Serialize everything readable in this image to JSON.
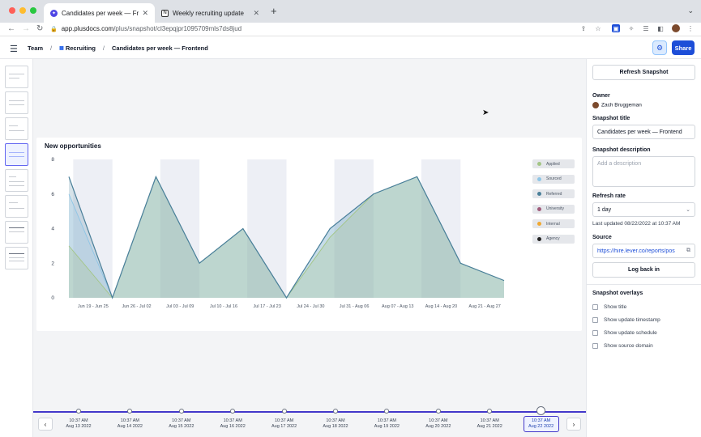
{
  "browser": {
    "tabs": [
      {
        "title": "Candidates per week — Fronte",
        "active": true
      },
      {
        "title": "Weekly recruiting update",
        "active": false
      }
    ],
    "url_host": "app.plusdocs.com",
    "url_path": "/plus/snapshot/cl3epqjpr1095709mls7ds8jud"
  },
  "header": {
    "breadcrumbs": [
      "Team",
      "Recruiting",
      "Candidates per week — Frontend"
    ],
    "share_label": "Share"
  },
  "chart_data": {
    "type": "area",
    "title": "New opportunities",
    "categories": [
      "Jun 19 - Jun 25",
      "Jun 26 - Jul 02",
      "Jul 03 - Jul 09",
      "Jul 10 - Jul 16",
      "Jul 17 - Jul 23",
      "Jul 24 - Jul 30",
      "Jul 31 - Aug 06",
      "Aug 07 - Aug 13",
      "Aug 14 - Aug 20",
      "Aug 21 - Aug 27"
    ],
    "ylim": [
      0,
      8
    ],
    "yticks": [
      0,
      2,
      4,
      6,
      8
    ],
    "series": [
      {
        "name": "Applied",
        "color": "#a3c585",
        "values": [
          3,
          0,
          7,
          2,
          4,
          0,
          3.5,
          6,
          7,
          2,
          1
        ]
      },
      {
        "name": "Sourced",
        "color": "#8ec5e6",
        "values": [
          6,
          0,
          7,
          2,
          4,
          0,
          4,
          6,
          7,
          2,
          1
        ]
      },
      {
        "name": "Referred",
        "color": "#4a7f99",
        "values": [
          7,
          0,
          7,
          2,
          4,
          0,
          4,
          6,
          7,
          2,
          1
        ]
      },
      {
        "name": "University",
        "color": "#a05c7b"
      },
      {
        "name": "Internal",
        "color": "#f0a830"
      },
      {
        "name": "Agency",
        "color": "#222222"
      }
    ]
  },
  "timeline": {
    "entries": [
      {
        "time": "10:37 AM",
        "date": "Aug 13 2022"
      },
      {
        "time": "10:37 AM",
        "date": "Aug 14 2022"
      },
      {
        "time": "10:37 AM",
        "date": "Aug 15 2022"
      },
      {
        "time": "10:37 AM",
        "date": "Aug 16 2022"
      },
      {
        "time": "10:37 AM",
        "date": "Aug 17 2022"
      },
      {
        "time": "10:37 AM",
        "date": "Aug 18 2022"
      },
      {
        "time": "10:37 AM",
        "date": "Aug 19 2022"
      },
      {
        "time": "10:37 AM",
        "date": "Aug 20 2022"
      },
      {
        "time": "10:37 AM",
        "date": "Aug 21 2022"
      },
      {
        "time": "10:37 AM",
        "date": "Aug 22 2022"
      }
    ]
  },
  "panel": {
    "refresh_button": "Refresh Snapshot",
    "owner_label": "Owner",
    "owner_name": "Zach Bruggeman",
    "title_label": "Snapshot title",
    "title_value": "Candidates per week — Frontend",
    "desc_label": "Snapshot description",
    "desc_placeholder": "Add a description",
    "rate_label": "Refresh rate",
    "rate_value": "1 day",
    "last_updated": "Last updated 08/22/2022 at 10:37 AM",
    "source_label": "Source",
    "source_url": "https://hire.lever.co/reports/pos",
    "login_button": "Log back in",
    "overlays_label": "Snapshot overlays",
    "overlays": [
      "Show title",
      "Show update timestamp",
      "Show update schedule",
      "Show source domain"
    ]
  }
}
